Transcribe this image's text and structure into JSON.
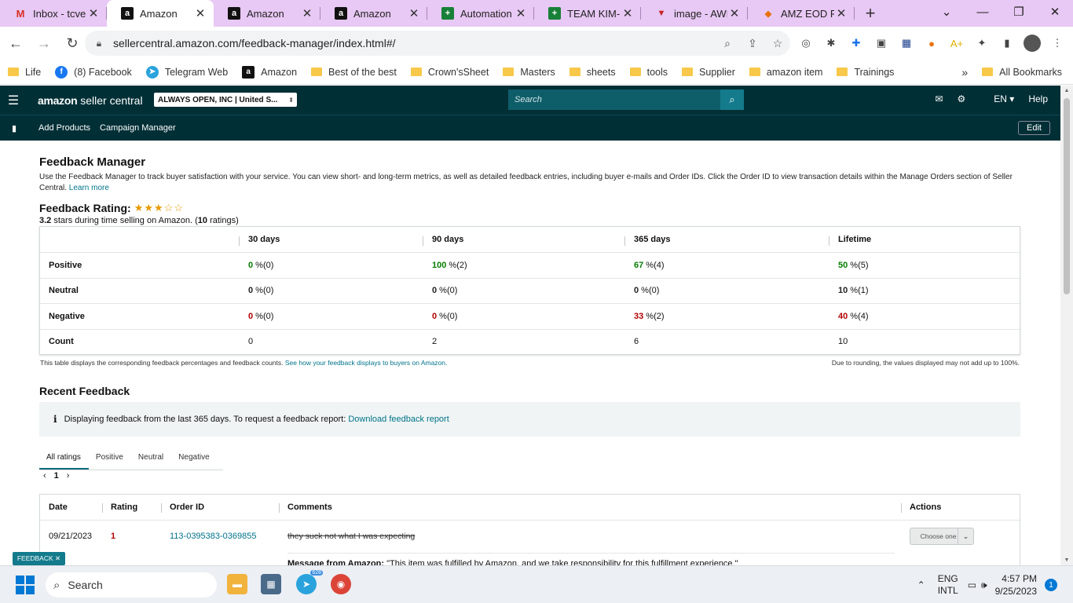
{
  "browser": {
    "tabs": [
      {
        "title": "Inbox - tcvent",
        "icon": "gmail-icon",
        "active": false
      },
      {
        "title": "Amazon",
        "icon": "amazon-icon",
        "active": true
      },
      {
        "title": "Amazon",
        "icon": "amazon-icon",
        "active": false
      },
      {
        "title": "Amazon",
        "icon": "amazon-icon",
        "active": false
      },
      {
        "title": "Automation A",
        "icon": "sheets-icon",
        "active": false
      },
      {
        "title": "TEAM KIM-RE",
        "icon": "sheets-icon",
        "active": false
      },
      {
        "title": "image - AWL",
        "icon": "image-icon",
        "active": false
      },
      {
        "title": "AMZ EOD Rep",
        "icon": "eod-icon",
        "active": false
      }
    ],
    "url": "sellercentral.amazon.com/feedback-manager/index.html#/",
    "bookmarks": [
      {
        "label": "Life",
        "type": "folder"
      },
      {
        "label": "(8) Facebook",
        "type": "facebook"
      },
      {
        "label": "Telegram Web",
        "type": "telegram"
      },
      {
        "label": "Amazon",
        "type": "amazon"
      },
      {
        "label": "Best of the best",
        "type": "folder"
      },
      {
        "label": "Crown'sSheet",
        "type": "folder"
      },
      {
        "label": "Masters",
        "type": "folder"
      },
      {
        "label": "sheets",
        "type": "folder"
      },
      {
        "label": "tools",
        "type": "folder"
      },
      {
        "label": "Supplier",
        "type": "folder"
      },
      {
        "label": "amazon item",
        "type": "folder"
      },
      {
        "label": "Trainings",
        "type": "folder"
      }
    ],
    "all_bookmarks": "All Bookmarks"
  },
  "seller_central": {
    "logo_bold": "amazon",
    "logo_rest": " seller central",
    "account": "ALWAYS OPEN, INC | United S...",
    "search_placeholder": "Search",
    "lang": "EN",
    "help": "Help",
    "subnav": [
      "Add Products",
      "Campaign Manager"
    ],
    "edit": "Edit"
  },
  "page": {
    "title": "Feedback Manager",
    "intro": "Use the Feedback Manager to track buyer satisfaction with your service. You can view short- and long-term metrics, as well as detailed feedback entries, including buyer e-mails and Order IDs. Click the Order ID to view transaction details within the Manage Orders section of Seller Central.",
    "learn_more": "Learn more",
    "rating_label": "Feedback Rating:",
    "rating_stars": 3,
    "rating_star_max": 5,
    "stars_value": "3.2",
    "stars_text": " stars during time selling on Amazon. (",
    "ratings_count": "10",
    "ratings_suffix": " ratings)",
    "table_headers": [
      "30 days",
      "90 days",
      "365 days",
      "Lifetime"
    ],
    "rows": [
      {
        "label": "Positive",
        "kind": "pos",
        "cells": [
          [
            "0",
            " %(0)"
          ],
          [
            "100",
            " %(2)"
          ],
          [
            "67",
            " %(4)"
          ],
          [
            "50",
            " %(5)"
          ]
        ]
      },
      {
        "label": "Neutral",
        "kind": "neu",
        "cells": [
          [
            "0",
            " %(0)"
          ],
          [
            "0",
            " %(0)"
          ],
          [
            "0",
            " %(0)"
          ],
          [
            "10",
            " %(1)"
          ]
        ]
      },
      {
        "label": "Negative",
        "kind": "neg",
        "cells": [
          [
            "0",
            " %(0)"
          ],
          [
            "0",
            " %(0)"
          ],
          [
            "33",
            " %(2)"
          ],
          [
            "40",
            " %(4)"
          ]
        ]
      },
      {
        "label": "Count",
        "kind": "count",
        "cells": [
          [
            "0",
            ""
          ],
          [
            "2",
            ""
          ],
          [
            "6",
            ""
          ],
          [
            "10",
            ""
          ]
        ]
      }
    ],
    "table_note_left": "This table displays the corresponding feedback percentages and feedback counts.",
    "table_note_link": "See how your feedback displays to buyers on Amazon.",
    "table_note_right": "Due to rounding, the values displayed may not add up to 100%.",
    "recent_title": "Recent Feedback",
    "info_text": "Displaying feedback from the last 365 days. To request a feedback report:",
    "info_link": "Download feedback report",
    "filter_tabs": [
      "All ratings",
      "Positive",
      "Neutral",
      "Negative"
    ],
    "page_num": "1",
    "recent_headers": {
      "date": "Date",
      "rating": "Rating",
      "order": "Order ID",
      "comments": "Comments",
      "actions": "Actions"
    },
    "entry": {
      "date": "09/21/2023",
      "rating": "1",
      "order_id": "113-0395383-0369855",
      "comment": "they suck not what I was expecting",
      "action": "Choose one",
      "msg_label": "Message from Amazon:",
      "msg_text": " \"This item was fulfilled by Amazon, and we take responsibility for this fulfillment experience.\""
    },
    "feedback_tag": "FEEDBACK ✕"
  },
  "taskbar": {
    "search": "Search",
    "telegram_badge": "628",
    "lang1": "ENG",
    "lang2": "INTL",
    "time": "4:57 PM",
    "date": "9/25/2023",
    "notifications": "1"
  },
  "colors": {
    "nav": "#002f36",
    "positive": "#067d00",
    "negative": "#b30000",
    "link": "#00748a",
    "tabstrip": "#e8c8f4"
  }
}
